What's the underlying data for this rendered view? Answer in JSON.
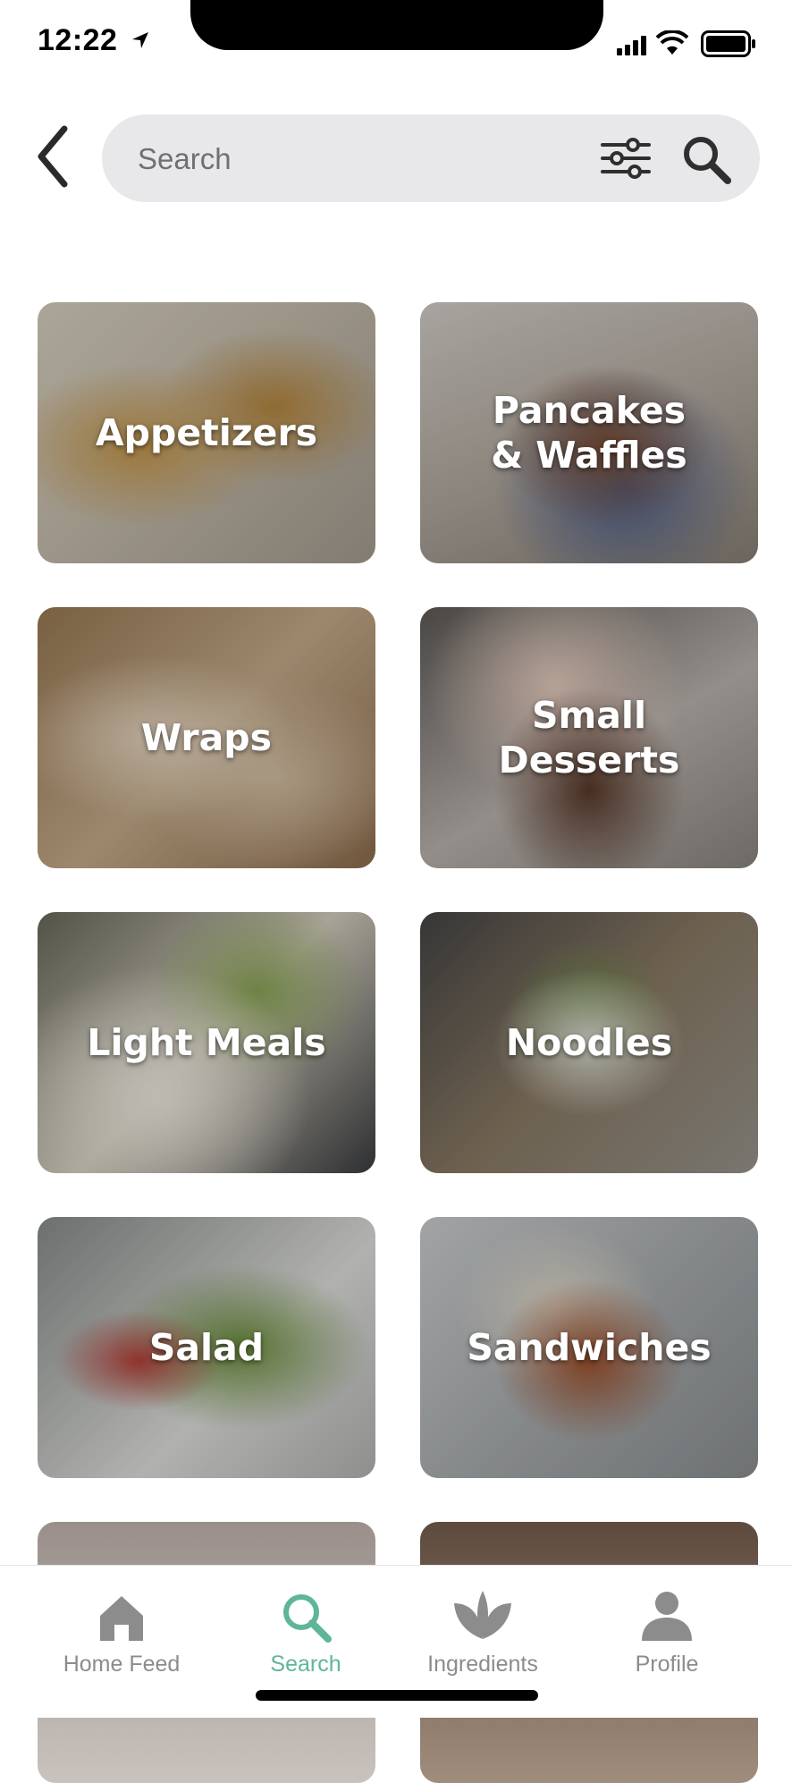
{
  "status_bar": {
    "time": "12:22"
  },
  "search": {
    "placeholder": "Search"
  },
  "categories": [
    {
      "label": "Appetizers"
    },
    {
      "label": "Pancakes & Waffles"
    },
    {
      "label": "Wraps"
    },
    {
      "label": "Small Desserts"
    },
    {
      "label": "Light Meals"
    },
    {
      "label": "Noodles"
    },
    {
      "label": "Salad"
    },
    {
      "label": "Sandwiches"
    }
  ],
  "tabs": [
    {
      "label": "Home Feed",
      "icon": "home-icon",
      "active": false
    },
    {
      "label": "Search",
      "icon": "search-icon",
      "active": true
    },
    {
      "label": "Ingredients",
      "icon": "leaf-icon",
      "active": false
    },
    {
      "label": "Profile",
      "icon": "person-icon",
      "active": false
    }
  ],
  "colors": {
    "accent": "#5fb59a",
    "inactive": "#8c8c8c",
    "search_bg": "#e8e8ea"
  }
}
